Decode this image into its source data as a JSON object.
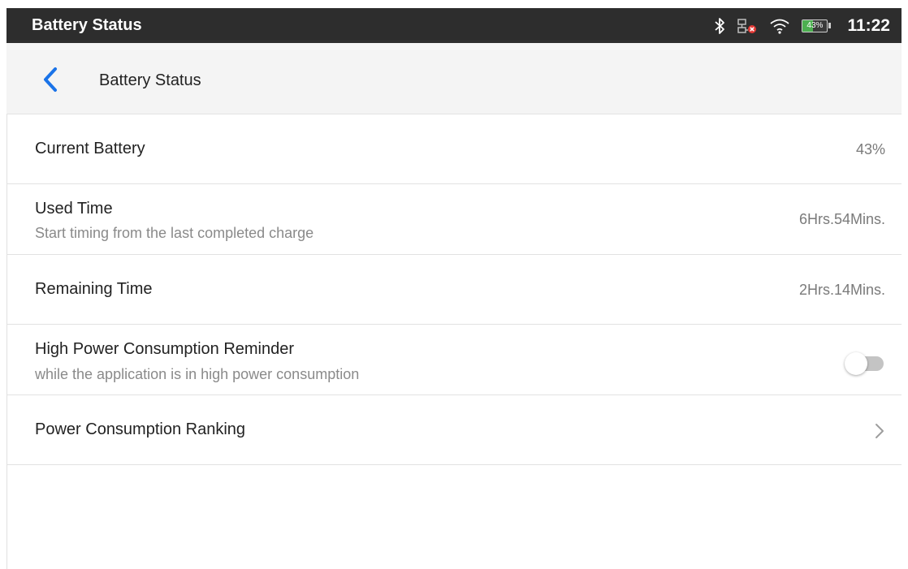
{
  "status_bar": {
    "title": "Battery Status",
    "battery_percent_text": "43%",
    "battery_level": 0.43,
    "time": "11:22",
    "icons": [
      "bluetooth-icon",
      "network-disconnected-icon",
      "wifi-icon",
      "battery-icon"
    ]
  },
  "header": {
    "back_icon": "chevron-left-icon",
    "title": "Battery Status"
  },
  "rows": {
    "current_battery": {
      "label": "Current Battery",
      "value": "43%"
    },
    "used_time": {
      "label": "Used Time",
      "sublabel": "Start timing from the last completed charge",
      "value": "6Hrs.54Mins."
    },
    "remaining_time": {
      "label": "Remaining Time",
      "value": "2Hrs.14Mins."
    },
    "high_power_reminder": {
      "label": "High Power Consumption Reminder",
      "sublabel": "while the application is in high power consumption",
      "enabled": false
    },
    "power_ranking": {
      "label": "Power Consumption Ranking",
      "icon": "chevron-right-icon"
    }
  },
  "colors": {
    "status_bar_bg": "#2d2d2d",
    "header_bg": "#f4f4f4",
    "accent": "#1a73e8",
    "battery_green": "#4caf50"
  }
}
